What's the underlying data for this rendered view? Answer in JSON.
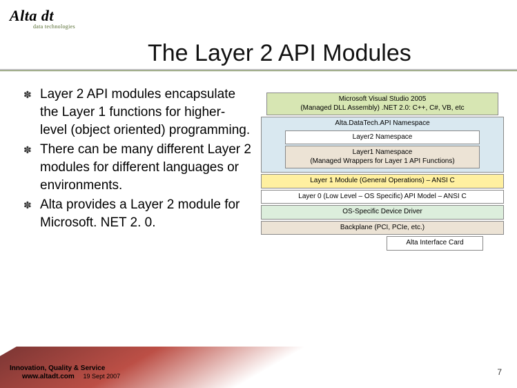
{
  "logo": {
    "main": "Alta dt",
    "sub": "data technologies"
  },
  "title": "The Layer 2 API Modules",
  "bullets": [
    "Layer 2 API modules encapsulate the Layer 1 functions for higher-level (object oriented) programming.",
    "There can be many different Layer 2 modules for different languages or environments.",
    "Alta provides a Layer 2 module for Microsoft. NET 2. 0."
  ],
  "diagram": {
    "vs_line1": "Microsoft Visual Studio 2005",
    "vs_line2": "(Managed DLL Assembly) .NET 2.0: C++, C#, VB, etc",
    "ns": "Alta.DataTech.API Namespace",
    "l2ns": "Layer2 Namespace",
    "l1ns_line1": "Layer1 Namespace",
    "l1ns_line2": "(Managed Wrappers for Layer 1 API Functions)",
    "l1mod": "Layer 1 Module (General Operations) – ANSI C",
    "l0": "Layer 0 (Low Level – OS Specific) API Model – ANSI C",
    "drv": "OS-Specific Device Driver",
    "bp": "Backplane (PCI, PCIe, etc.)",
    "card": "Alta Interface Card"
  },
  "footer": {
    "tagline": "Innovation, Quality & Service",
    "url": "www.altadt.com",
    "date": "19 Sept 2007"
  },
  "page": "7"
}
